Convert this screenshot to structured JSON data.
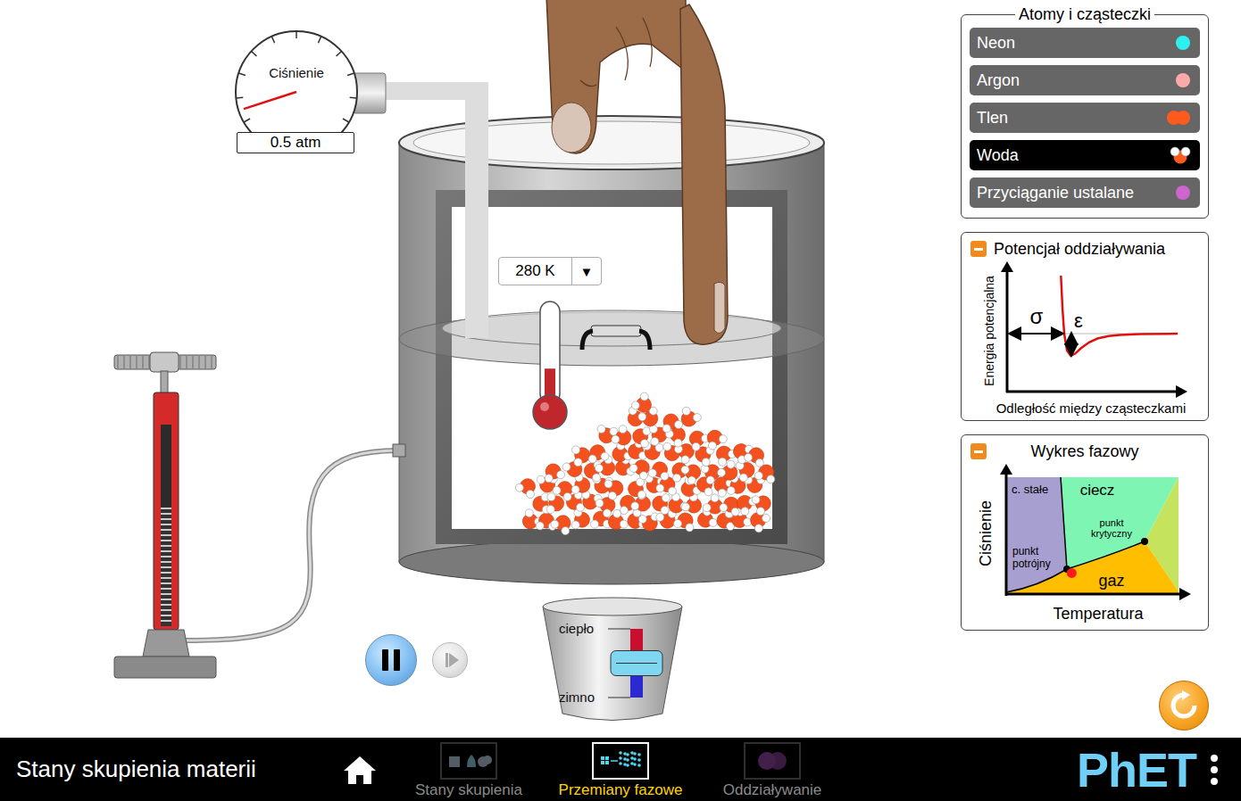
{
  "sim": {
    "pressure_gauge": {
      "title": "Ciśnienie",
      "reading": "0.5 atm",
      "level": 0.05
    },
    "thermometer": {
      "reading": "280 K",
      "dropdown_icon": "▼",
      "level": 0.35
    },
    "heater": {
      "hot_label": "ciepło",
      "cold_label": "zimno",
      "level": 0.5
    },
    "playback": {
      "playing": true,
      "step_disabled": true
    }
  },
  "atoms_panel": {
    "title": "Atomy i cząsteczki",
    "items": [
      {
        "label": "Neon",
        "selected": false,
        "kind": "atom",
        "color": "#2ff0f0"
      },
      {
        "label": "Argon",
        "selected": false,
        "kind": "atom",
        "color": "#ffaaaa"
      },
      {
        "label": "Tlen",
        "selected": false,
        "kind": "diatomic",
        "color": "#ff5a1e"
      },
      {
        "label": "Woda",
        "selected": true,
        "kind": "water",
        "color": "#ff5a1e"
      },
      {
        "label": "Przyciąganie ustalane",
        "selected": false,
        "kind": "atom",
        "color": "#cc66cc"
      }
    ]
  },
  "potential_panel": {
    "title": "Potencjał oddziaływania",
    "expanded": true,
    "y_axis": "Energia potencjalna",
    "x_axis": "Odległość między cząsteczkami",
    "sigma": "σ",
    "epsilon": "ε",
    "curve": [
      [
        0.94,
        2.6
      ],
      [
        0.97,
        1.1
      ],
      [
        1.0,
        0
      ],
      [
        1.05,
        -0.76
      ],
      [
        1.12,
        -1.0
      ],
      [
        1.2,
        -0.89
      ],
      [
        1.3,
        -0.66
      ],
      [
        1.45,
        -0.39
      ],
      [
        1.6,
        -0.22
      ],
      [
        1.8,
        -0.11
      ],
      [
        2.0,
        -0.06
      ],
      [
        2.4,
        -0.02
      ],
      [
        2.9,
        -0.01
      ],
      [
        3.05,
        -0.005
      ]
    ]
  },
  "phase_panel": {
    "title": "Wykres fazowy",
    "expanded": true,
    "y_axis": "Ciśnienie",
    "x_axis": "Temperatura",
    "regions": [
      {
        "label": "c. stałe",
        "color": "#a79fcf"
      },
      {
        "label": "ciecz",
        "color": "#7ff5b3"
      },
      {
        "label": "gaz",
        "color": "#ffbf00"
      }
    ],
    "triple_point": [
      "punkt",
      "potrójny"
    ],
    "critical_point": [
      "punkt",
      "krytyczny"
    ],
    "state": {
      "t": 0.38,
      "p": 0.18
    }
  },
  "nav": {
    "title": "Stany skupienia materii",
    "tabs": [
      {
        "label": "Stany skupienia",
        "selected": false
      },
      {
        "label": "Przemiany fazowe",
        "selected": true
      },
      {
        "label": "Oddziaływanie",
        "selected": false
      }
    ],
    "logo": "PhET"
  }
}
